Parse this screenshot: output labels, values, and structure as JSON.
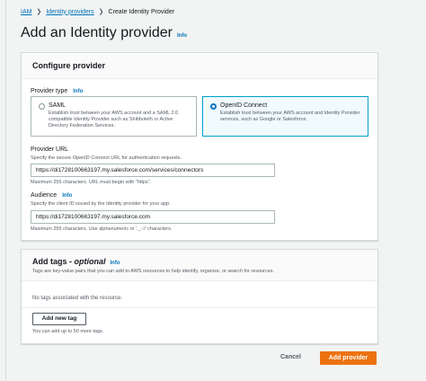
{
  "breadcrumb": {
    "items": [
      "IAM",
      "Identity providers"
    ],
    "current": "Create Identity Provider"
  },
  "page": {
    "title": "Add an Identity provider",
    "info": "Info"
  },
  "configure": {
    "title": "Configure provider",
    "provider_type_label": "Provider type",
    "provider_type_info": "Info",
    "options": [
      {
        "title": "SAML",
        "desc": "Establish trust between your AWS account and a SAML 2.0 compatible Identity Provider such as Shibboleth or Active Directory Federation Services.",
        "selected": false
      },
      {
        "title": "OpenID Connect",
        "desc": "Establish trust between your AWS account and Identity Provider services, such as Google or Salesforce.",
        "selected": true
      }
    ],
    "provider_url": {
      "label": "Provider URL",
      "desc": "Specify the secure OpenID Connect URL for authentication requests.",
      "value": "https://di1728100663197.my.salesforce.com/services/connectors",
      "hint": "Maximum 255 characters. URL must begin with \"https\"."
    },
    "audience": {
      "label": "Audience",
      "info": "Info",
      "desc": "Specify the client ID issued by the Identity provider for your app.",
      "value": "https://di1728100663197.my.salesforce.com",
      "hint": "Maximum 255 characters. Use alphanumeric or '._-:/' characters."
    }
  },
  "tags": {
    "title": "Add tags - ",
    "title_optional": "optional",
    "info": "Info",
    "desc": "Tags are key-value pairs that you can add to AWS resources to help identify, organize, or search for resources.",
    "empty": "No tags associated with the resource.",
    "add_button": "Add new tag",
    "hint": "You can add up to 50 more tags."
  },
  "footer": {
    "cancel": "Cancel",
    "submit": "Add provider"
  },
  "colors": {
    "primary": "#ec7211",
    "link": "#0073bb",
    "selected_border": "#00a1c9"
  }
}
